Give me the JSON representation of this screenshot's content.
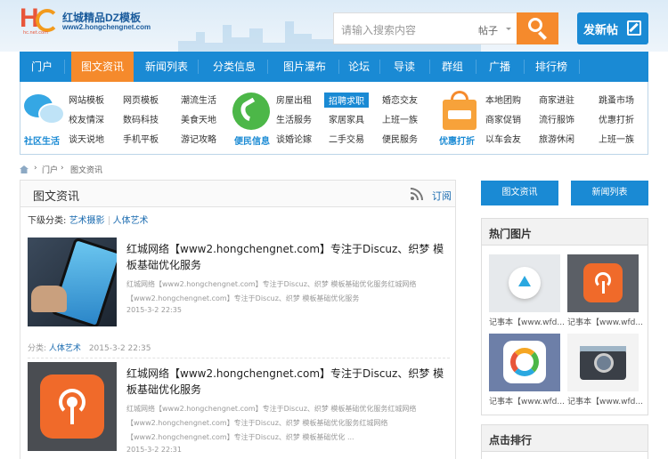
{
  "header": {
    "site_title": "红城精品DZ模板",
    "site_url": "www2.hongchengnet.com",
    "logo_tag": "hc.net.com",
    "search_placeholder": "请输入搜索内容",
    "search_category": "帖子",
    "post_label": "发新帖"
  },
  "nav": {
    "items": [
      "门户",
      "图文资讯",
      "新闻列表",
      "分类信息",
      "图片瀑布",
      "论坛",
      "导读",
      "群组",
      "广播",
      "排行榜"
    ],
    "active": "图文资讯"
  },
  "subnav": {
    "groups": [
      {
        "label": "社区生活",
        "icon": "chat-bubbles-icon",
        "color": "#1a8ad4",
        "links": [
          [
            "网站模板",
            "网页模板",
            "潮流生活"
          ],
          [
            "校友情深",
            "数码科技",
            "美食天地"
          ],
          [
            "谈天说地",
            "手机平板",
            "游记攻略"
          ]
        ]
      },
      {
        "label": "便民信息",
        "icon": "phone-icon",
        "color": "#1a8ad4",
        "links": [
          [
            "房屋出租",
            "招聘求职",
            "婚恋交友"
          ],
          [
            "生活服务",
            "家居家具",
            "上班一族"
          ],
          [
            "谈婚论嫁",
            "二手交易",
            "便民服务"
          ]
        ]
      },
      {
        "label": "优惠打折",
        "icon": "shopping-bag-icon",
        "color": "#1a8ad4",
        "links": [
          [
            "本地团购",
            "商家进驻",
            "跳蚤市场"
          ],
          [
            "商家促销",
            "流行服饰",
            "优惠打折"
          ],
          [
            "以车会友",
            "旅游休闲",
            "上班一族"
          ]
        ]
      }
    ],
    "highlight": "招聘求职"
  },
  "breadcrumb": [
    "门户",
    "图文资讯"
  ],
  "main": {
    "title": "图文资讯",
    "subscribe": "订阅",
    "subcat_label": "下级分类:",
    "subcats": [
      "艺术摄影",
      "人体艺术"
    ],
    "articles": [
      {
        "title": "红城网络【www2.hongchengnet.com】专注于Discuz、织梦 模板基础优化服务",
        "summary": "红城网络【www2.hongchengnet.com】专注于Discuz、织梦 模板基础优化服务红城网络【www2.hongchengnet.com】专注于Discuz、织梦 模板基础优化服务",
        "date": "2015-3-2 22:35",
        "meta_label": "分类:",
        "meta_cat": "人体艺术",
        "meta_date": "2015-3-2 22:35"
      },
      {
        "title": "红城网络【www2.hongchengnet.com】专注于Discuz、织梦 模板基础优化服务",
        "summary": "红城网络【www2.hongchengnet.com】专注于Discuz、织梦 模板基础优化服务红城网络【www2.hongchengnet.com】专注于Discuz、织梦 模板基础优化服务红城网络【www2.hongchengnet.com】专注于Discuz、织梦 模板基础优化 ...",
        "date": "2015-3-2 22:31"
      }
    ]
  },
  "sidebar": {
    "btn1": "图文资讯",
    "btn2": "新闻列表",
    "hot_title": "热门图片",
    "hot_items": [
      "记事本【www.wfd...",
      "记事本【www.wfd...",
      "记事本【www.wfd...",
      "记事本【www.wfd..."
    ],
    "rank_title": "点击排行"
  }
}
